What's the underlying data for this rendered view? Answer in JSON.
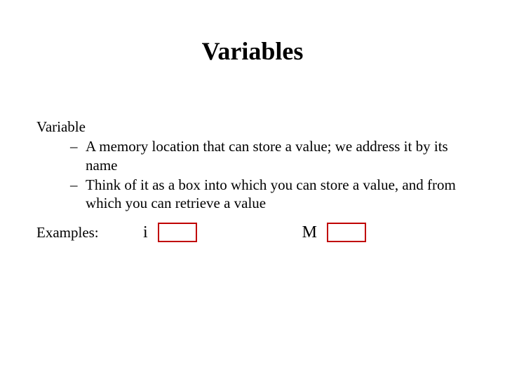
{
  "title": "Variables",
  "term": "Variable",
  "bullets": [
    "A memory location that can store a value; we address it by its name",
    "Think of it as a box into which you can store a value, and from which you can retrieve a value"
  ],
  "examples_label": "Examples:",
  "examples": [
    {
      "name": "i"
    },
    {
      "name": "M"
    }
  ],
  "box_border_color": "#c00000"
}
